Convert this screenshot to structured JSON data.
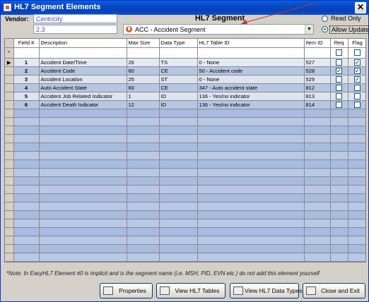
{
  "window": {
    "title": "HL7 Segment Elements"
  },
  "vendor": {
    "label": "Vendor:",
    "name": "Centricity",
    "version": "2.3"
  },
  "segment": {
    "heading": "HL7 Segment",
    "selected": "ACC - Accident Segment"
  },
  "mode": {
    "options": [
      "Read Only",
      "Allow Update"
    ],
    "selected": "Allow Update"
  },
  "grid": {
    "columns": [
      "Field #",
      "Description",
      "Max Size",
      "Data Type",
      "HL7 Table ID",
      "Item ID",
      "Req",
      "Flag"
    ],
    "new_row_marker": "*",
    "rows": [
      {
        "field": "1",
        "description": "Accident Date/Time",
        "max_size": "26",
        "data_type": "TS",
        "table": "0 - None",
        "item_id": "527",
        "req": false,
        "flag": true
      },
      {
        "field": "2",
        "description": "Accident Code",
        "max_size": "60",
        "data_type": "CE",
        "table": "50 - Accident code",
        "item_id": "528",
        "req": true,
        "flag": true
      },
      {
        "field": "3",
        "description": "Accident Location",
        "max_size": "25",
        "data_type": "ST",
        "table": "0 - None",
        "item_id": "529",
        "req": false,
        "flag": true
      },
      {
        "field": "4",
        "description": "Auto Accident State",
        "max_size": "60",
        "data_type": "CE",
        "table": "347 - Auto accident state",
        "item_id": "812",
        "req": false,
        "flag": false
      },
      {
        "field": "5",
        "description": "Accident Job Related Indicator",
        "max_size": "1",
        "data_type": "ID",
        "table": "136 - Yes/no indicator",
        "item_id": "813",
        "req": false,
        "flag": false
      },
      {
        "field": "6",
        "description": "Accident Death Indicator",
        "max_size": "12",
        "data_type": "ID",
        "table": "136 - Yes/no indicator",
        "item_id": "814",
        "req": false,
        "flag": false
      }
    ]
  },
  "note": "*Note:  In EasyHL7 Element #0 is implicit and is the segment name (i.e. MSH, PID, EVN etc.) do not add this element yourself",
  "buttons": {
    "properties": "Properties",
    "view_tables": "View HL7 Tables",
    "view_types": "View HL7 Data Types",
    "close": "Close and Exit"
  }
}
